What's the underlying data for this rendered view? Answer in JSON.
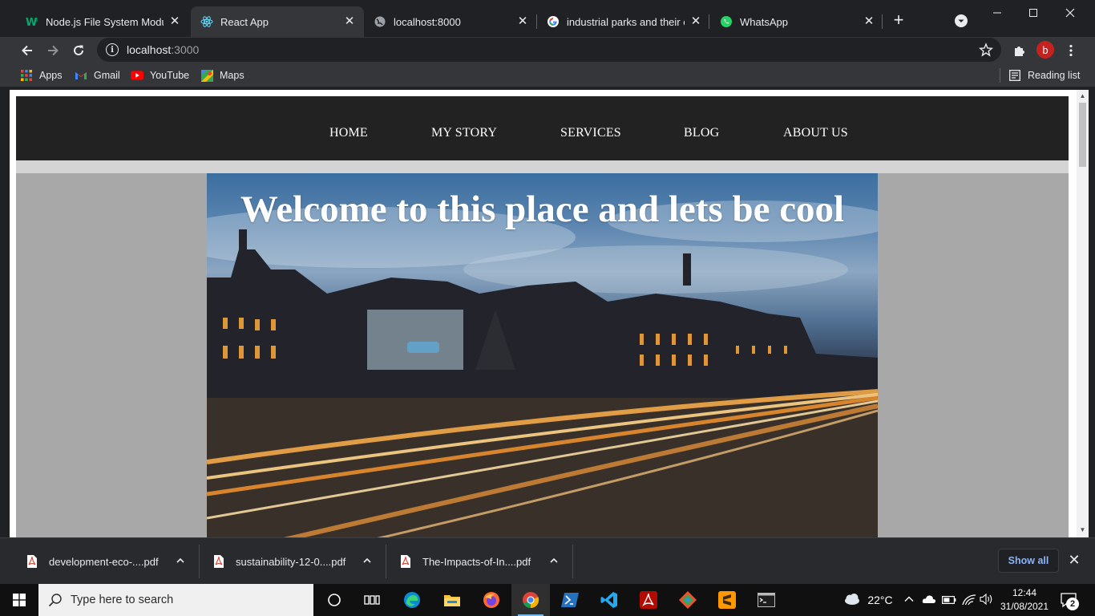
{
  "browser": {
    "tabs": [
      {
        "title": "Node.js File System Module",
        "active": false
      },
      {
        "title": "React App",
        "active": true
      },
      {
        "title": "localhost:8000",
        "active": false
      },
      {
        "title": "industrial parks and their eco",
        "active": false
      },
      {
        "title": "WhatsApp",
        "active": false
      }
    ],
    "new_tab_label": "+",
    "address": {
      "host": "localhost",
      "port": ":3000"
    },
    "bookmarks": [
      {
        "label": "Apps"
      },
      {
        "label": "Gmail"
      },
      {
        "label": "YouTube"
      },
      {
        "label": "Maps"
      }
    ],
    "reading_list_label": "Reading list",
    "profile_initial": "b"
  },
  "page": {
    "nav": [
      "HOME",
      "MY STORY",
      "SERVICES",
      "BLOG",
      "ABOUT US"
    ],
    "hero_title": "Welcome to this place and lets be cool"
  },
  "downloads": {
    "items": [
      {
        "name": "development-eco-....pdf"
      },
      {
        "name": "sustainability-12-0....pdf"
      },
      {
        "name": "The-Impacts-of-In....pdf"
      }
    ],
    "show_all_label": "Show all"
  },
  "taskbar": {
    "search_placeholder": "Type here to search",
    "weather": "22°C",
    "time": "12:44",
    "date": "31/08/2021",
    "notification_count": "2"
  },
  "colors": {
    "browser_dark": "#202124",
    "toolbar": "#35363a",
    "navbar": "#222222",
    "page_grey": "#a8a8a8",
    "link_blue": "#8ab4f8",
    "taskbar": "#101010"
  }
}
